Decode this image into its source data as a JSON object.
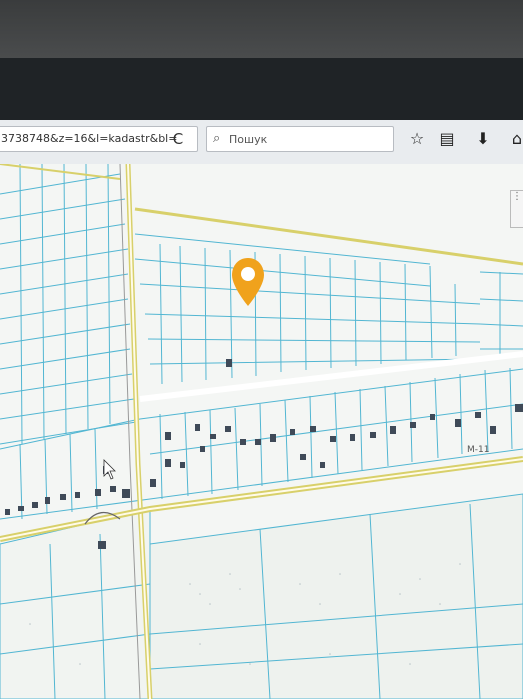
{
  "browser": {
    "url_text": "3738748&z=16&l=kadastr&bl=",
    "search_placeholder": "Пошук",
    "reload_glyph": "C"
  },
  "toolbar_icons": [
    "star-icon",
    "library-icon",
    "download-icon",
    "home-icon"
  ],
  "map": {
    "road_label": "M-11",
    "colors": {
      "parcel_line": "#52b6d2",
      "background": "#f4f6f4",
      "road": "#d8d06a",
      "building": "#3f4a58",
      "pin": "#f0a21c"
    }
  }
}
